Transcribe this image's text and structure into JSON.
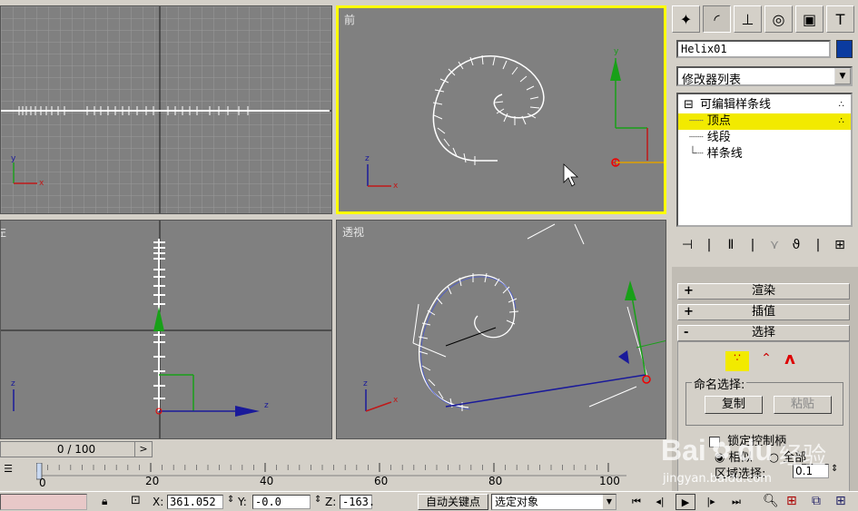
{
  "viewports": {
    "top_left": {
      "label": ""
    },
    "front": {
      "label": "前"
    },
    "left": {
      "label": "左"
    },
    "perspective": {
      "label": "透视"
    }
  },
  "axes": {
    "x": "x",
    "y": "y",
    "z": "z"
  },
  "command_panel": {
    "tabs": [
      "create-icon",
      "modify-icon",
      "hierarchy-icon",
      "motion-icon",
      "display-icon",
      "utilities-icon"
    ],
    "object_name": "Helix01",
    "object_color": "#0b3ba0",
    "modifier_list_label": "修改器列表",
    "stack": {
      "root": "可编辑样条线",
      "items": [
        "顶点",
        "线段",
        "样条线"
      ],
      "expand_sign": "⊟"
    },
    "rollouts": [
      {
        "sign": "+",
        "label": "渲染"
      },
      {
        "sign": "+",
        "label": "插值"
      },
      {
        "sign": "-",
        "label": "选择"
      }
    ],
    "selection": {
      "named_selection_title": "命名选择:",
      "copy_label": "复制",
      "paste_label": "粘贴",
      "lock_handles_label": "锁定控制柄",
      "similar_label": "相似",
      "all_label": "全部",
      "area_selection_label": "区域选择:",
      "area_value": "0.1"
    }
  },
  "timeline": {
    "frame_display": "0 / 100",
    "next_arrow": ">",
    "ticks": [
      "0",
      "20",
      "40",
      "60",
      "80",
      "100"
    ]
  },
  "status_bar": {
    "x_label": "X:",
    "x_value": "361.052",
    "y_label": "Y:",
    "y_value": "-0.0",
    "z_label": "Z:",
    "z_value": "-163.",
    "auto_key_label": "自动关键点",
    "selection_filter": "选定对象"
  },
  "playback": [
    "⏮",
    "◂|",
    "▶",
    "|▸",
    "⏭"
  ],
  "watermark": {
    "brand": "Bai",
    "paw": "du",
    "suffix": "经验",
    "url": "jingyan.baidu.com"
  }
}
